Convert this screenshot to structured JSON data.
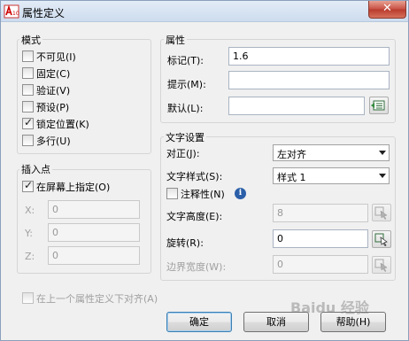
{
  "window": {
    "title": "属性定义",
    "close": "✕"
  },
  "mode": {
    "title": "模式",
    "items": [
      {
        "label": "不可见(I)",
        "checked": false
      },
      {
        "label": "固定(C)",
        "checked": false
      },
      {
        "label": "验证(V)",
        "checked": false
      },
      {
        "label": "预设(P)",
        "checked": false
      },
      {
        "label": "锁定位置(K)",
        "checked": true
      },
      {
        "label": "多行(U)",
        "checked": false
      }
    ]
  },
  "insertion": {
    "title": "插入点",
    "on_screen_label": "在屏幕上指定(O)",
    "on_screen_checked": true,
    "x_label": "X:",
    "x_value": "0",
    "y_label": "Y:",
    "y_value": "0",
    "z_label": "Z:",
    "z_value": "0"
  },
  "attribute": {
    "title": "属性",
    "tag_label": "标记(T):",
    "tag_value": "1.6",
    "prompt_label": "提示(M):",
    "prompt_value": "",
    "default_label": "默认(L):",
    "default_value": ""
  },
  "text_settings": {
    "title": "文字设置",
    "justify_label": "对正(J):",
    "justify_value": "左对齐",
    "style_label": "文字样式(S):",
    "style_value": "样式 1",
    "annotative_label": "注释性(N)",
    "annotative_checked": false,
    "height_label": "文字高度(E):",
    "height_value": "8",
    "rotation_label": "旋转(R):",
    "rotation_value": "0",
    "boundary_label": "边界宽度(W):",
    "boundary_value": "0"
  },
  "align_below": {
    "label": "在上一个属性定义下对齐(A)",
    "checked": false
  },
  "buttons": {
    "ok": "确定",
    "cancel": "取消",
    "help": "帮助(H)"
  },
  "watermark": "Baidu 经验",
  "colors": {
    "accent": "#3c7fb1",
    "close": "#c75043"
  }
}
